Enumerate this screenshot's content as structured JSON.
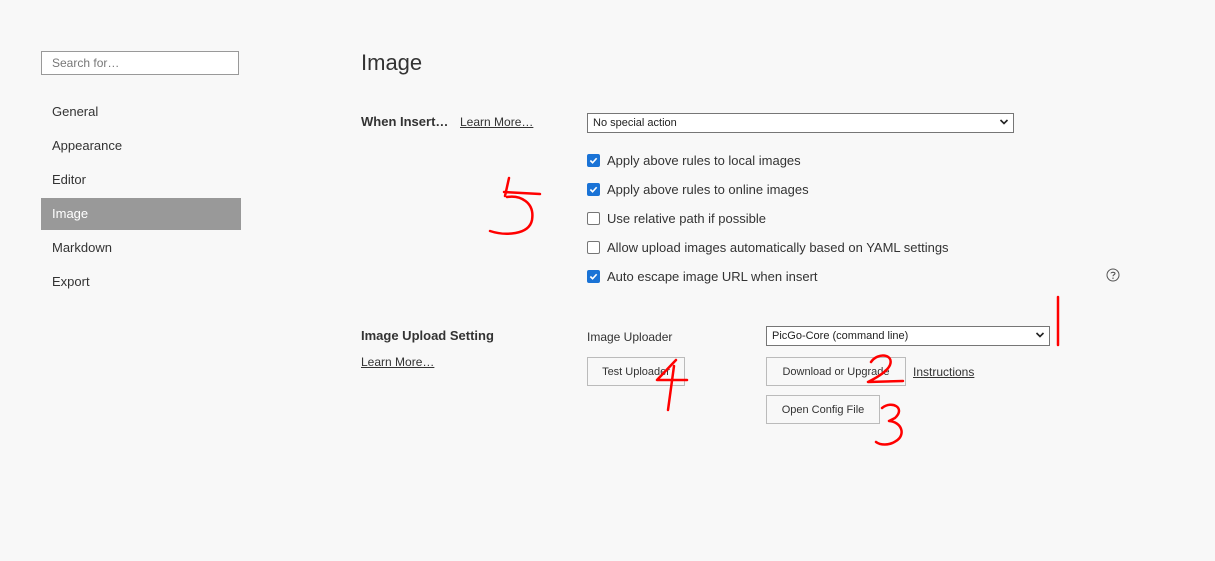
{
  "sidebar": {
    "search_placeholder": "Search for…",
    "items": [
      {
        "label": "General"
      },
      {
        "label": "Appearance"
      },
      {
        "label": "Editor"
      },
      {
        "label": "Image"
      },
      {
        "label": "Markdown"
      },
      {
        "label": "Export"
      }
    ],
    "active": "Image"
  },
  "main": {
    "title": "Image",
    "when_insert": {
      "label": "When Insert…",
      "learn_more": "Learn More…",
      "select_value": "No special action"
    },
    "options": [
      {
        "label": "Apply above rules to local images",
        "checked": true
      },
      {
        "label": "Apply above rules to online images",
        "checked": true
      },
      {
        "label": "Use relative path if possible",
        "checked": false
      },
      {
        "label": "Allow upload images automatically based on YAML settings",
        "checked": false
      },
      {
        "label": "Auto escape image URL when insert",
        "checked": true
      }
    ],
    "upload": {
      "label": "Image Upload Setting",
      "learn_more": "Learn More…",
      "uploader_label": "Image Uploader",
      "uploader_value": "PicGo-Core (command line)",
      "test_button": "Test Uploader",
      "download_button": "Download or Upgrade",
      "instructions_link": "Instructions",
      "config_button": "Open Config File"
    }
  },
  "annotations": {
    "color": "#ff0000",
    "marks": [
      "1",
      "2",
      "3",
      "4",
      "5"
    ]
  },
  "colors": {
    "checkbox_on": "#1a73d6",
    "nav_active_bg": "#999999"
  }
}
